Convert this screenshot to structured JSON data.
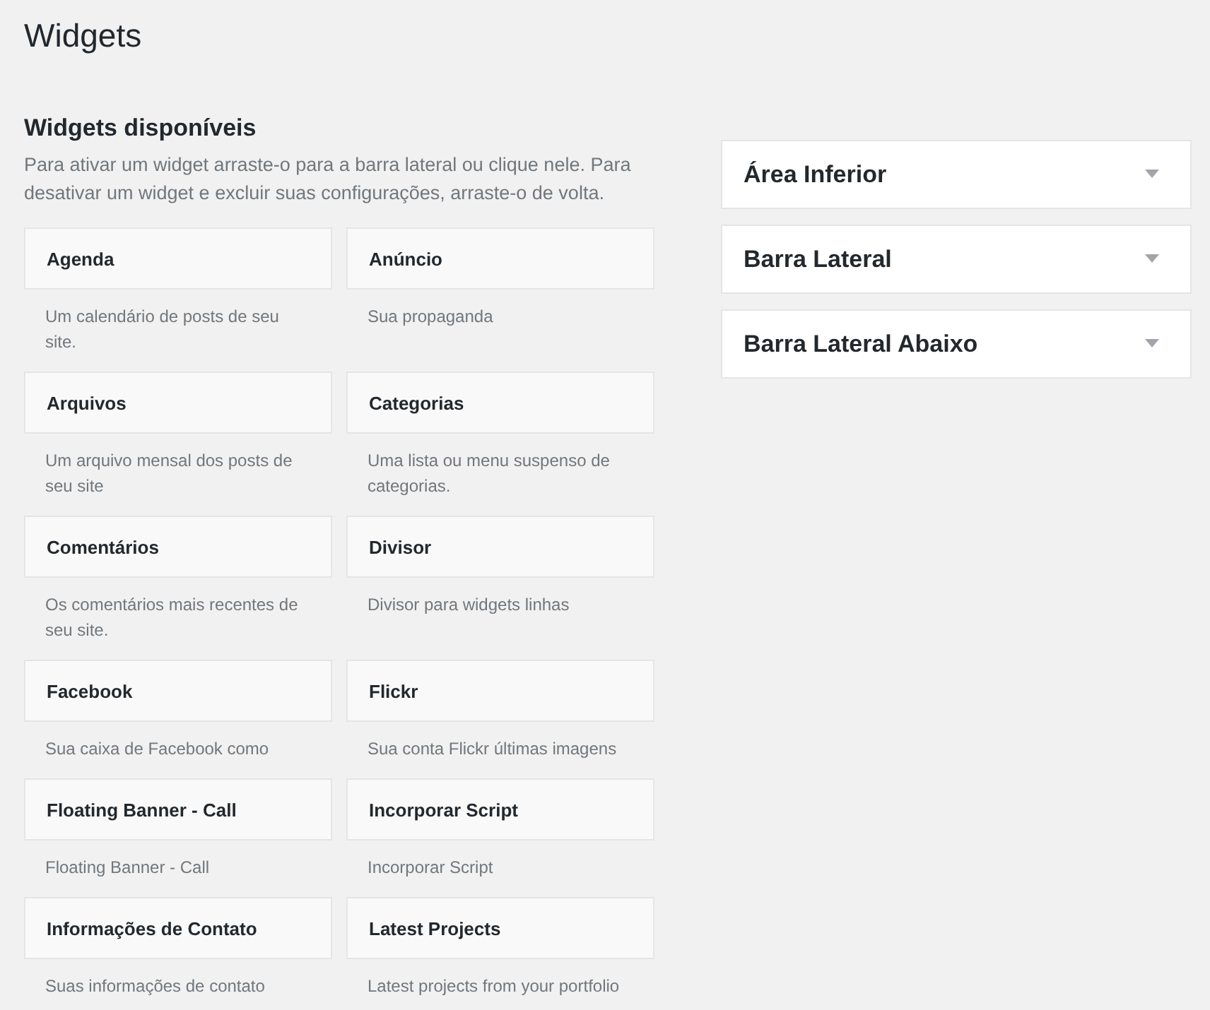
{
  "title": "Widgets",
  "available": {
    "heading": "Widgets disponíveis",
    "description": "Para ativar um widget arraste-o para a barra lateral ou clique nele. Para desativar um widget e excluir suas configurações, arraste-o de volta.",
    "widgets": [
      {
        "name": "Agenda",
        "description": "Um calendário de posts de seu site."
      },
      {
        "name": "Anúncio",
        "description": "Sua propaganda"
      },
      {
        "name": "Arquivos",
        "description": "Um arquivo mensal dos posts de seu site"
      },
      {
        "name": "Categorias",
        "description": "Uma lista ou menu suspenso de categorias."
      },
      {
        "name": "Comentários",
        "description": "Os comentários mais recentes de seu site."
      },
      {
        "name": "Divisor",
        "description": "Divisor para widgets linhas"
      },
      {
        "name": "Facebook",
        "description": "Sua caixa de Facebook como"
      },
      {
        "name": "Flickr",
        "description": "Sua conta Flickr últimas imagens"
      },
      {
        "name": "Floating Banner - Call",
        "description": "Floating Banner - Call"
      },
      {
        "name": "Incorporar Script",
        "description": "Incorporar Script"
      },
      {
        "name": "Informações de Contato",
        "description": "Suas informações de contato"
      },
      {
        "name": "Latest Projects",
        "description": "Latest projects from your portfolio"
      }
    ]
  },
  "areas": [
    {
      "name": "Área Inferior",
      "expanded": false
    },
    {
      "name": "Barra Lateral",
      "expanded": false
    },
    {
      "name": "Barra Lateral Abaixo",
      "expanded": false
    }
  ]
}
